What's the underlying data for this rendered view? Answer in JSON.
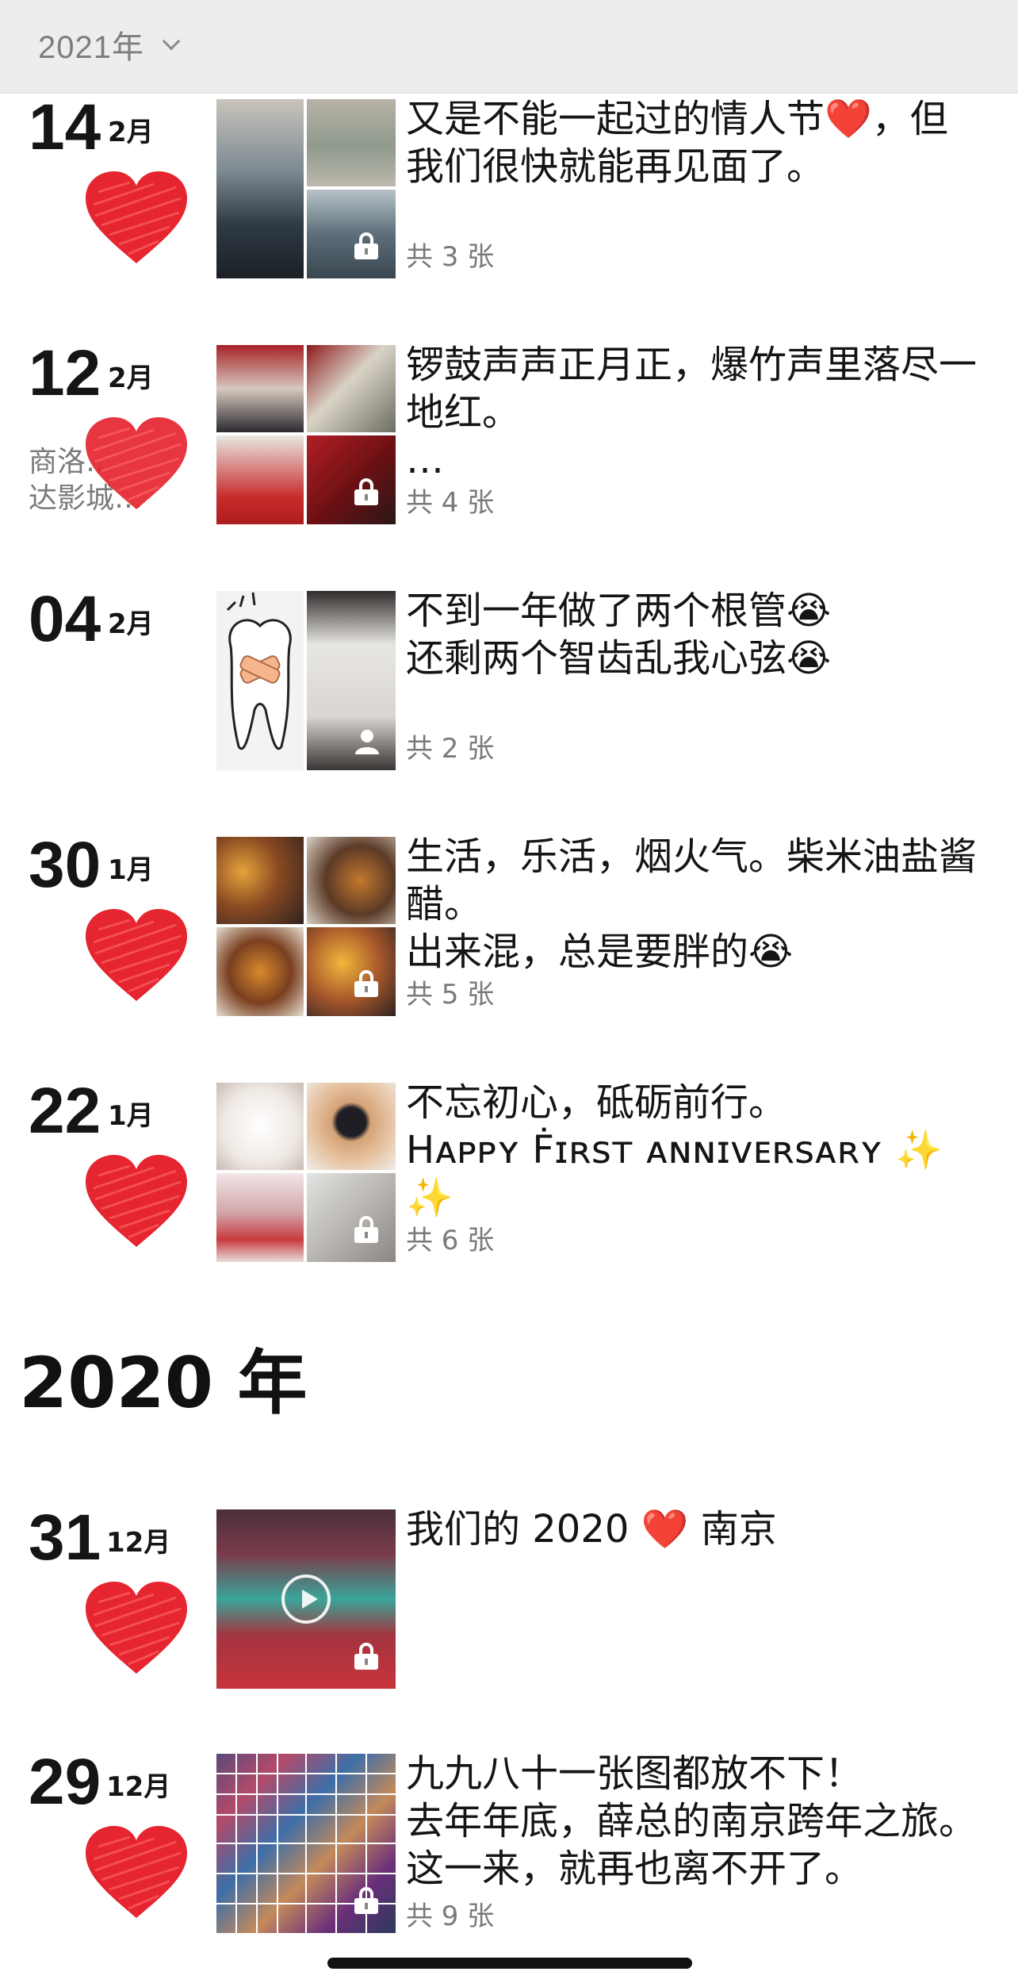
{
  "header": {
    "year_label": "2021年"
  },
  "section_2020": {
    "title": "2020 年"
  },
  "entries": [
    {
      "day": "14",
      "month": "2月",
      "location": "",
      "count": "共 3 张",
      "text_lines": [
        "又是不能一起过的情人节❤️，但",
        "我们很快就能再见面了。"
      ]
    },
    {
      "day": "12",
      "month": "2月",
      "location": "商洛…\n达影城…",
      "count": "共 4 张",
      "text_lines": [
        "锣鼓声声正月正，爆竹声里落尽一",
        "地红。",
        "…"
      ]
    },
    {
      "day": "04",
      "month": "2月",
      "location": "",
      "count": "共 2 张",
      "text_lines": [
        "不到一年做了两个根管😭",
        "还剩两个智齿乱我心弦😭"
      ]
    },
    {
      "day": "30",
      "month": "1月",
      "location": "",
      "count": "共 5 张",
      "text_lines": [
        "生活，乐活，烟火气。柴米油盐酱",
        "醋。",
        "出来混，总是要胖的😭"
      ]
    },
    {
      "day": "22",
      "month": "1月",
      "location": "",
      "count": "共 6 张",
      "text_lines": [
        "不忘初心，砥砺前行。",
        "Hᴀᴘᴘʏ Ḟɪʀsᴛ ᴀɴɴɪᴠᴇʀsᴀʀʏ ✨ ✨"
      ]
    },
    {
      "day": "31",
      "month": "12月",
      "location": "",
      "count": "",
      "text_lines": [
        "我们的 2020 ❤️ 南京"
      ]
    },
    {
      "day": "29",
      "month": "12月",
      "location": "",
      "count": "共 9 张",
      "text_lines": [
        "九九八十一张图都放不下！",
        "去年年底，薛总的南京跨年之旅。",
        "这一来，就再也离不开了。"
      ]
    }
  ]
}
